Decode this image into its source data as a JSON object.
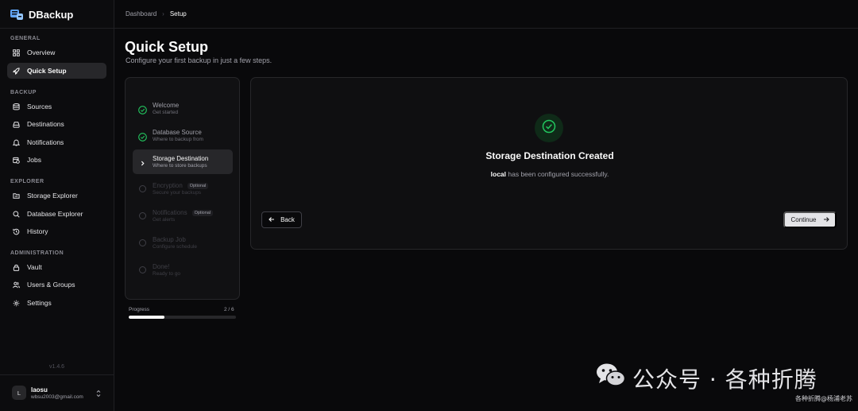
{
  "app": {
    "name": "DBackup",
    "version": "v1.4.6"
  },
  "sidebar": {
    "sections": [
      {
        "label": "GENERAL",
        "items": [
          {
            "label": "Overview",
            "icon": "grid-icon"
          },
          {
            "label": "Quick Setup",
            "icon": "rocket-icon",
            "active": true
          }
        ]
      },
      {
        "label": "BACKUP",
        "items": [
          {
            "label": "Sources",
            "icon": "database-icon"
          },
          {
            "label": "Destinations",
            "icon": "hard-drive-icon"
          },
          {
            "label": "Notifications",
            "icon": "bell-icon"
          },
          {
            "label": "Jobs",
            "icon": "calendar-clock-icon"
          }
        ]
      },
      {
        "label": "EXPLORER",
        "items": [
          {
            "label": "Storage Explorer",
            "icon": "folder-search-icon"
          },
          {
            "label": "Database Explorer",
            "icon": "search-db-icon"
          },
          {
            "label": "History",
            "icon": "history-icon"
          }
        ]
      },
      {
        "label": "ADMINISTRATION",
        "items": [
          {
            "label": "Vault",
            "icon": "lock-icon"
          },
          {
            "label": "Users & Groups",
            "icon": "users-icon"
          },
          {
            "label": "Settings",
            "icon": "gear-icon"
          }
        ]
      }
    ]
  },
  "user": {
    "initial": "L",
    "name": "laosu",
    "email": "wbsu2003@gmail.com"
  },
  "breadcrumb": {
    "parent": "Dashboard",
    "current": "Setup"
  },
  "page": {
    "title": "Quick Setup",
    "subtitle": "Configure your first backup in just a few steps."
  },
  "steps": [
    {
      "title": "Welcome",
      "subtitle": "Get started",
      "state": "done"
    },
    {
      "title": "Database Source",
      "subtitle": "Where to backup from",
      "state": "done"
    },
    {
      "title": "Storage Destination",
      "subtitle": "Where to store backups",
      "state": "current"
    },
    {
      "title": "Encryption",
      "subtitle": "Secure your backups",
      "state": "pending",
      "badge": "Optional"
    },
    {
      "title": "Notifications",
      "subtitle": "Get alerts",
      "state": "pending",
      "badge": "Optional"
    },
    {
      "title": "Backup Job",
      "subtitle": "Configure schedule",
      "state": "pending"
    },
    {
      "title": "Done!",
      "subtitle": "Ready to go",
      "state": "pending"
    }
  ],
  "progress": {
    "label": "Progress",
    "count": "2 / 6",
    "fraction": 0.33
  },
  "result": {
    "title": "Storage Destination Created",
    "name": "local",
    "message": " has been configured successfully."
  },
  "buttons": {
    "back": "Back",
    "continue": "Continue"
  },
  "watermark": {
    "text": "公众号 · 各种折腾",
    "sub": "各种折腾@杨浦老苏"
  },
  "colors": {
    "success": "#22c55e",
    "accent": "#fafafa",
    "background": "#09090b"
  }
}
